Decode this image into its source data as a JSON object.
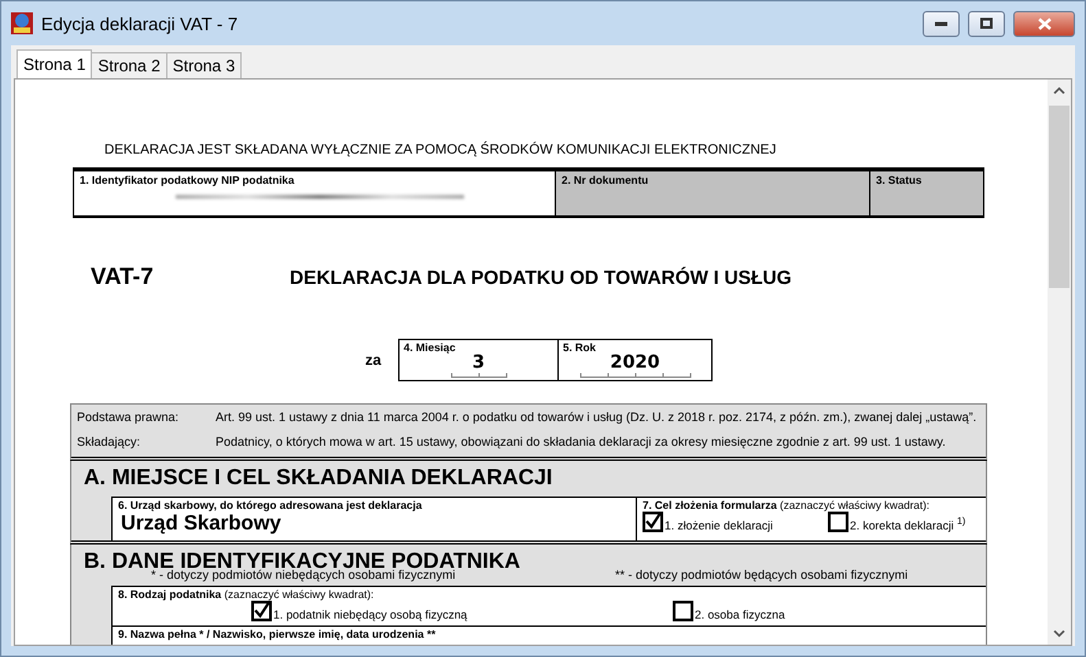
{
  "window": {
    "title": "Edycja deklaracji VAT - 7"
  },
  "tabs": [
    {
      "label": "Strona 1",
      "selected": true
    },
    {
      "label": "Strona 2",
      "selected": false
    },
    {
      "label": "Strona 3",
      "selected": false
    }
  ],
  "form": {
    "notice": "DEKLARACJA JEST SKŁADANA WYŁĄCZNIE ZA POMOCĄ ŚRODKÓW KOMUNIKACJI ELEKTRONICZNEJ",
    "header_fields": [
      {
        "label": "1. Identyfikator podatkowy NIP podatnika",
        "shaded": false,
        "redacted": true
      },
      {
        "label": "2. Nr dokumentu",
        "shaded": true,
        "redacted": false
      },
      {
        "label": "3. Status",
        "shaded": true,
        "redacted": false
      }
    ],
    "code": "VAT-7",
    "title": "DEKLARACJA DLA PODATKU OD TOWARÓW I USŁUG",
    "period": {
      "prefix": "za",
      "fields": [
        {
          "label": "4. Miesiąc",
          "value": "3"
        },
        {
          "label": "5. Rok",
          "value": "2020"
        }
      ]
    },
    "legal": [
      {
        "label": "Podstawa prawna:",
        "text": "Art. 99 ust. 1 ustawy z dnia 11 marca 2004 r. o podatku od towarów i usług (Dz. U. z 2018 r. poz. 2174, z późn. zm.),  zwanej dalej „ustawą”."
      },
      {
        "label": "Składający:",
        "text": "Podatnicy, o których mowa  w art. 15 ustawy, obowiązani do składania deklaracji za okresy miesięczne zgodnie z art. 99 ust. 1 ustawy."
      }
    ],
    "section_a": {
      "title": "A. MIEJSCE I CEL SKŁADANIA DEKLARACJI",
      "office": {
        "label": "6. Urząd skarbowy, do którego adresowana jest deklaracja",
        "value": "Urząd Skarbowy"
      },
      "purpose": {
        "label": "**7. Cel złożenia formularza** (zaznaczyć właściwy kwadrat):",
        "options": [
          {
            "label": "1. złożenie deklaracji",
            "checked": true
          },
          {
            "label": "2. korekta deklaracji $^{1)}$",
            "checked": false
          }
        ]
      }
    },
    "section_b": {
      "title": "B. DANE IDENTYFIKACYJNE PODATNIKA",
      "notes": [
        "* - dotyczy podmiotów niebędących osobami fizycznymi",
        "** - dotyczy podmiotów będących osobami fizycznymi"
      ],
      "taxpayer_type": {
        "label": "**8. Rodzaj podatnika** (zaznaczyć właściwy kwadrat):",
        "options": [
          {
            "label": "1. podatnik niebędący osobą fizyczną",
            "checked": true
          },
          {
            "label": "2. osoba fizyczna",
            "checked": false
          }
        ]
      },
      "name_field": {
        "label": "9. Nazwa pełna * / Nazwisko, pierwsze imię, data urodzenia **"
      }
    }
  }
}
